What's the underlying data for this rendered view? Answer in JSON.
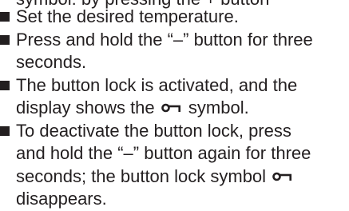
{
  "cut_off_line": "symbol: by pressing the + button",
  "steps": [
    {
      "lines": [
        "Set the desired temperature."
      ]
    },
    {
      "lines": [
        "Press and hold the “–” button for three",
        "seconds."
      ]
    },
    {
      "lines": [
        "The button lock is activated, and the",
        "display shows the"
      ],
      "suffix": "symbol."
    },
    {
      "lines": [
        "To deactivate the button lock, press",
        "and hold the “–” button again for three",
        "seconds; the button lock symbol"
      ],
      "after_icon": "disappears."
    }
  ],
  "icons": {
    "lock_symbol": "key-lock-icon",
    "bullet": "square-bullet-icon"
  }
}
